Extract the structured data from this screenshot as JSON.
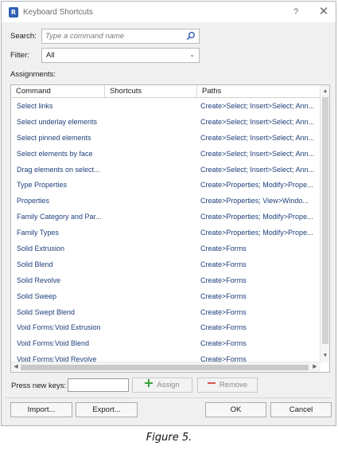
{
  "window": {
    "title": "Keyboard Shortcuts",
    "help": "?",
    "close": "✕",
    "app_icon": "R"
  },
  "search": {
    "label": "Search:",
    "placeholder": "Type a command name",
    "icon": "search-icon"
  },
  "filter": {
    "label": "Filter:",
    "value": "All"
  },
  "assignments": {
    "label": "Assignments:",
    "columns": [
      "Command",
      "Shortcuts",
      "Paths"
    ],
    "rows": [
      {
        "command": "Select links",
        "shortcut": "",
        "path": "Create>Select; Insert>Select; Ann..."
      },
      {
        "command": "Select underlay elements",
        "shortcut": "",
        "path": "Create>Select; Insert>Select; Ann..."
      },
      {
        "command": "Select pinned elements",
        "shortcut": "",
        "path": "Create>Select; Insert>Select; Ann..."
      },
      {
        "command": "Select elements by face",
        "shortcut": "",
        "path": "Create>Select; Insert>Select; Ann..."
      },
      {
        "command": "Drag elements on select...",
        "shortcut": "",
        "path": "Create>Select; Insert>Select; Ann..."
      },
      {
        "command": "Type Properties",
        "shortcut": "",
        "path": "Create>Properties; Modify>Prope..."
      },
      {
        "command": "Properties",
        "shortcut": "",
        "path": "Create>Properties; View>Windo..."
      },
      {
        "command": "Family Category and Par...",
        "shortcut": "",
        "path": "Create>Properties; Modify>Prope..."
      },
      {
        "command": "Family Types",
        "shortcut": "",
        "path": "Create>Properties; Modify>Prope..."
      },
      {
        "command": "Solid Extrusion",
        "shortcut": "",
        "path": "Create>Forms"
      },
      {
        "command": "Solid Blend",
        "shortcut": "",
        "path": "Create>Forms"
      },
      {
        "command": "Solid Revolve",
        "shortcut": "",
        "path": "Create>Forms"
      },
      {
        "command": "Solid Sweep",
        "shortcut": "",
        "path": "Create>Forms"
      },
      {
        "command": "Solid Swept Blend",
        "shortcut": "",
        "path": "Create>Forms"
      },
      {
        "command": "Void Forms:Void Extrusion",
        "shortcut": "",
        "path": "Create>Forms"
      },
      {
        "command": "Void Forms:Void Blend",
        "shortcut": "",
        "path": "Create>Forms"
      },
      {
        "command": "Void Forms:Void Revolve",
        "shortcut": "",
        "path": "Create>Forms"
      }
    ]
  },
  "keys": {
    "label": "Press new keys:",
    "value": "",
    "assign": "Assign",
    "remove": "Remove"
  },
  "footer": {
    "import": "Import...",
    "export": "Export...",
    "ok": "OK",
    "cancel": "Cancel"
  },
  "caption": "Figure 5.",
  "colors": {
    "command_text": "#1f3f7a",
    "assign_icon": "#3aa43a",
    "remove_icon": "#d9534f"
  }
}
